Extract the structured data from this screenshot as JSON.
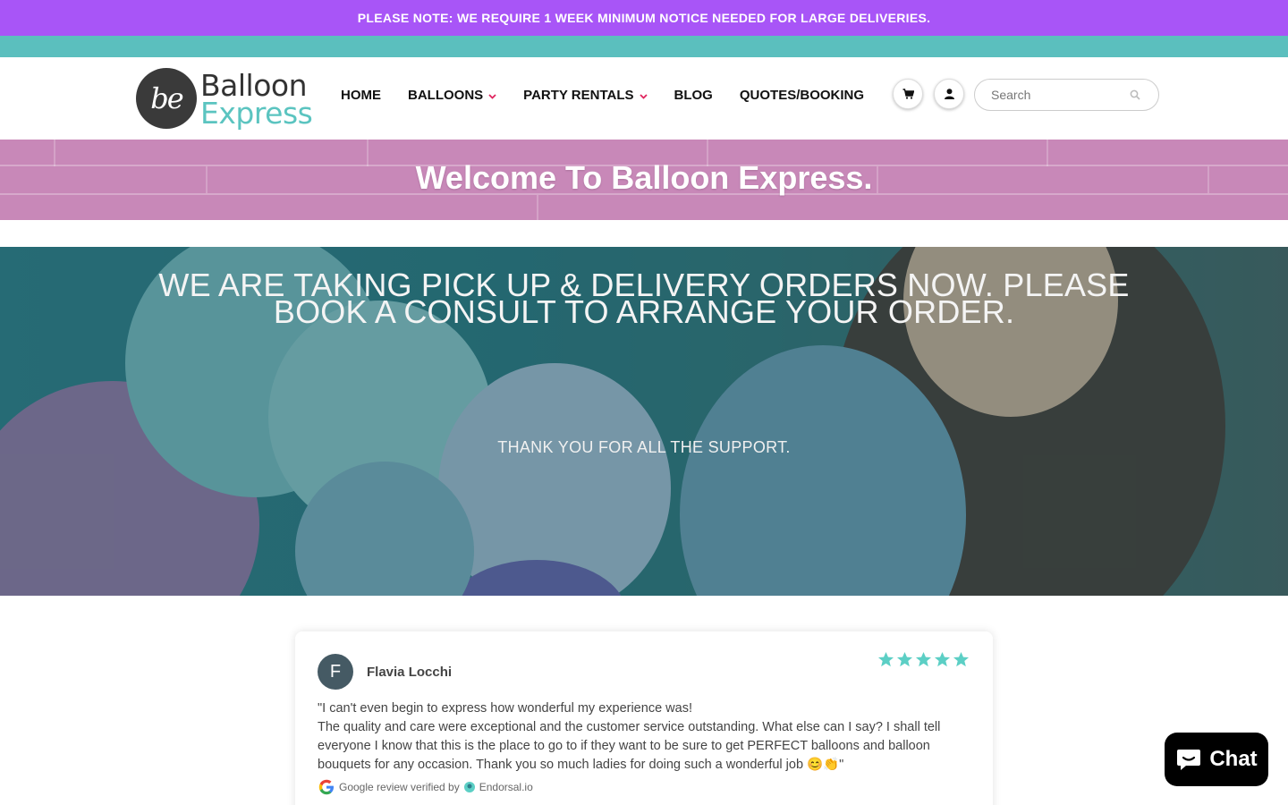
{
  "announcement": {
    "text": "PLEASE NOTE: WE REQUIRE 1 WEEK MINIMUM NOTICE NEEDED FOR LARGE DELIVERIES."
  },
  "logo": {
    "word1": "Balloon",
    "word2": "Express",
    "mark": "be"
  },
  "nav": {
    "items": [
      {
        "label": "HOME",
        "has_dropdown": false
      },
      {
        "label": "BALLOONS",
        "has_dropdown": true
      },
      {
        "label": "PARTY RENTALS",
        "has_dropdown": true
      },
      {
        "label": "BLOG",
        "has_dropdown": false
      },
      {
        "label": "QUOTES/BOOKING",
        "has_dropdown": false
      }
    ]
  },
  "header_icons": {
    "cart": "cart-icon",
    "account": "user-icon"
  },
  "search": {
    "placeholder": "Search",
    "value": ""
  },
  "banner": {
    "title": "Welcome To Balloon Express."
  },
  "hero": {
    "title": "WE ARE TAKING PICK UP & DELIVERY ORDERS NOW. PLEASE BOOK A CONSULT TO ARRANGE YOUR ORDER.",
    "subtitle": "THANK YOU FOR ALL THE SUPPORT."
  },
  "review": {
    "avatar_initial": "F",
    "reviewer": "Flavia Locchi",
    "rating": 5,
    "text_line1": "\"I can't even begin to express how wonderful my experience was!",
    "text_line2": "The quality and care were exceptional and the customer service outstanding. What else can I say?  I shall tell everyone I know that this is the place to go to if they want to be sure to get PERFECT balloons and balloon bouquets for any occasion.  Thank you so much ladies for doing such a wonderful job 😊👏\"",
    "verified_prefix": "Google review verified by",
    "verified_brand": "Endorsal.io"
  },
  "chat": {
    "label": "Chat"
  },
  "colors": {
    "announcement_bg": "#a855f7",
    "teal": "#5bbfbe",
    "star": "#5ccfc5",
    "nav_chevron": "#e0245e"
  }
}
